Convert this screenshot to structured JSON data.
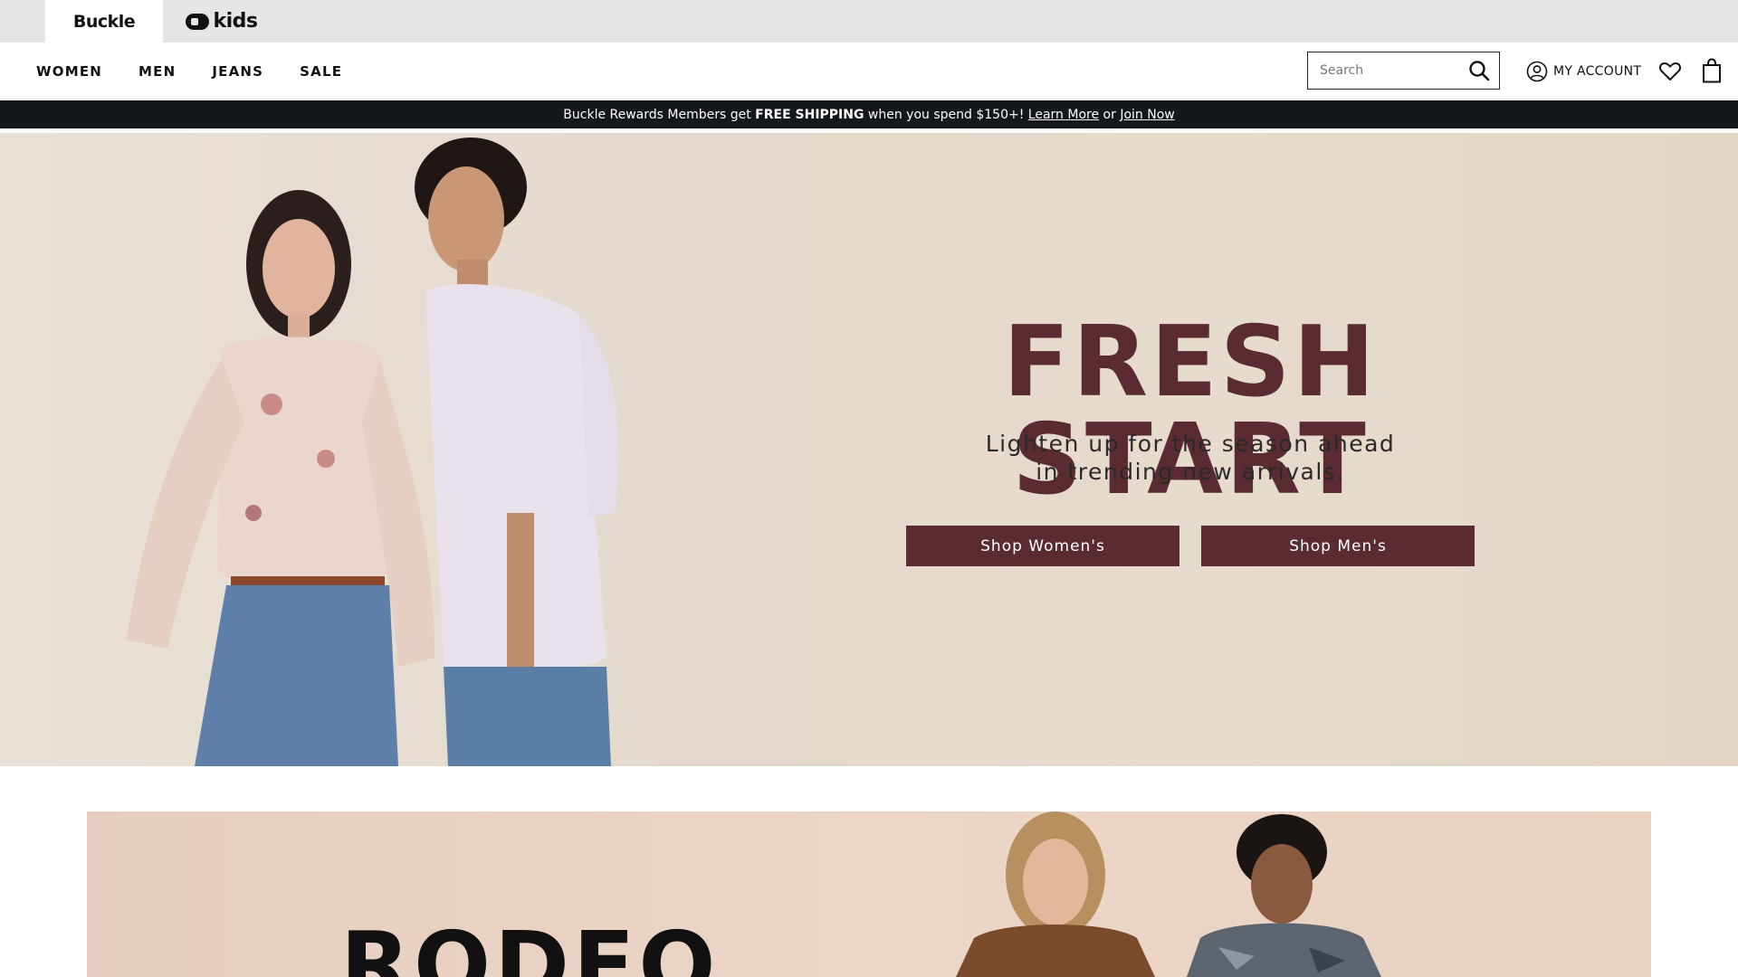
{
  "brand_bar": {
    "buckle_logo": "Buckle",
    "kids_logo": "kids"
  },
  "nav": {
    "links": [
      "WOMEN",
      "MEN",
      "JEANS",
      "SALE"
    ]
  },
  "search": {
    "placeholder": "Search"
  },
  "account": {
    "label": "MY ACCOUNT"
  },
  "promo": {
    "prefix": "Buckle Rewards Members get ",
    "highlight": "FREE SHIPPING",
    "middle": " when you spend $150+! ",
    "learn_more": "Learn More",
    "or": " or ",
    "join_now": "Join Now"
  },
  "hero": {
    "title": "FRESH START",
    "subtitle_line1": "Lighten up for the season ahead",
    "subtitle_line2": "in trending new arrivals.",
    "shop_women": "Shop Women's",
    "shop_men": "Shop Men's"
  },
  "rodeo": {
    "title": "RODEO"
  },
  "colors": {
    "accent": "#5a2b33",
    "promo_bg": "#14181c",
    "brand_bar_bg": "#e5e5e5"
  },
  "icons": [
    "search-icon",
    "account-icon",
    "heart-icon",
    "bag-icon"
  ]
}
